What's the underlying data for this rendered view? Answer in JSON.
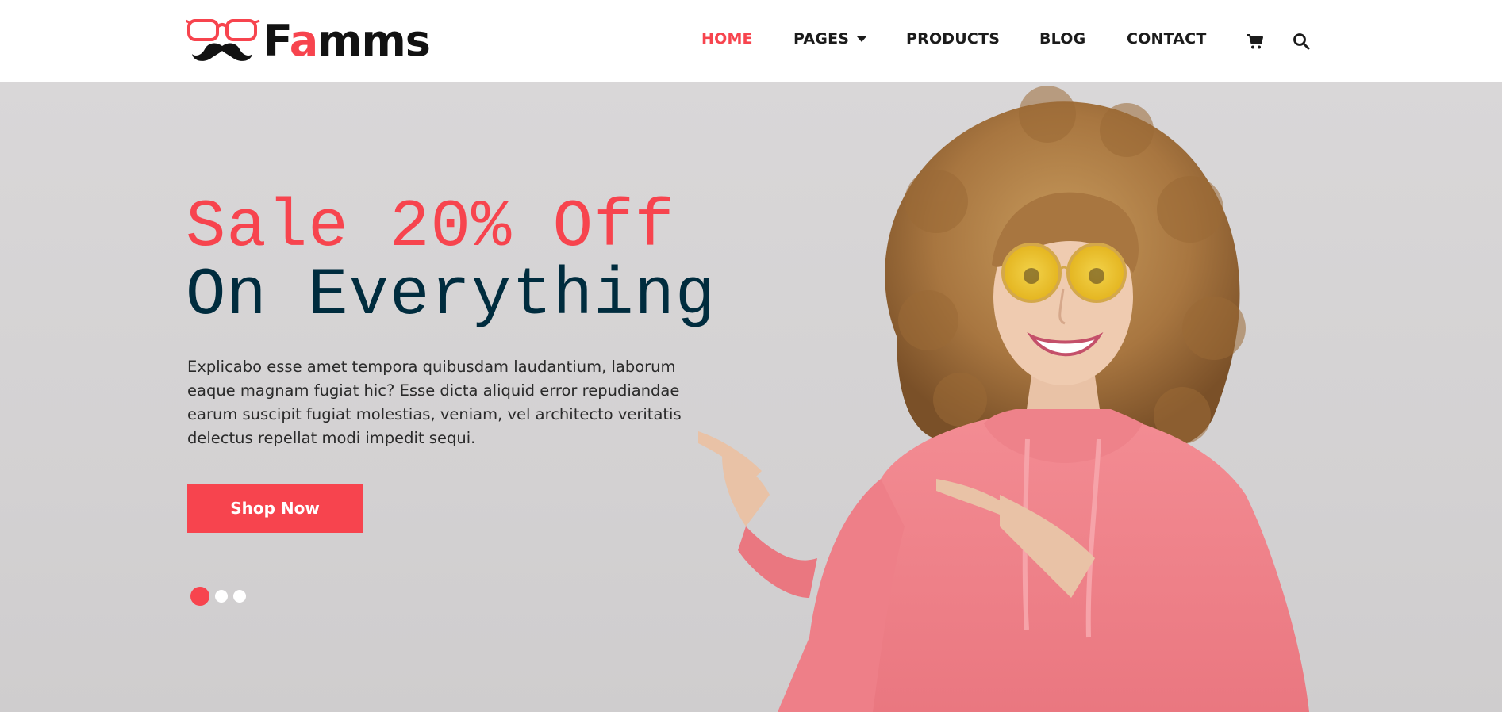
{
  "brand": {
    "name_prefix": "F",
    "name_accent": "a",
    "name_suffix": "mms",
    "accent_color": "#f7444e",
    "text_color": "#121212",
    "logo_icon": "glasses-mustache-icon"
  },
  "nav": {
    "items": [
      {
        "label": "HOME",
        "active": true
      },
      {
        "label": "PAGES",
        "has_dropdown": true
      },
      {
        "label": "PRODUCTS"
      },
      {
        "label": "BLOG"
      },
      {
        "label": "CONTACT"
      }
    ],
    "icons": [
      "cart-icon",
      "search-icon"
    ]
  },
  "hero": {
    "headline_line1": "Sale 20% Off",
    "headline_line2": "On Everything",
    "description": "Explicabo esse amet tempora quibusdam laudantium, laborum eaque magnam fugiat hic? Esse dicta aliquid error repudiandae earum suscipit fugiat molestias, veniam, vel architecto veritatis delectus repellat modi impedit sequi.",
    "cta_label": "Shop Now",
    "slides_total": 3,
    "active_slide": 1,
    "headline_color_1": "#f7444e",
    "headline_color_2": "#002c3e",
    "background_color": "#d6d4d5"
  }
}
